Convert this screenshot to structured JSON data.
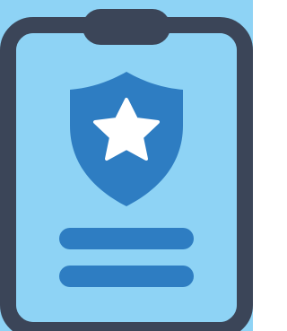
{
  "icon": {
    "name": "clipboard-badge-icon",
    "colors": {
      "background": "#8ED3F5",
      "frame": "#3B4558",
      "paper": "#8ED3F5",
      "shield": "#2E7DC2",
      "star": "#FFFFFF",
      "lines": "#2E7DC2"
    },
    "parts": [
      "clipboard-frame",
      "clip-top",
      "shield",
      "star",
      "line-1",
      "line-2"
    ]
  }
}
